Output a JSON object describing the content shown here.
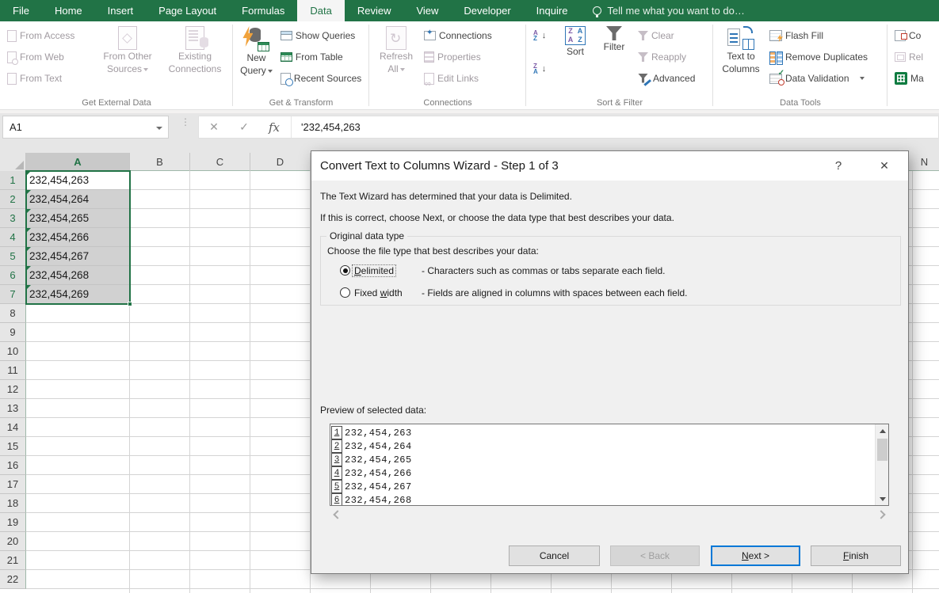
{
  "tabs": [
    "File",
    "Home",
    "Insert",
    "Page Layout",
    "Formulas",
    "Data",
    "Review",
    "View",
    "Developer",
    "Inquire"
  ],
  "tell_me": "Tell me what you want to do…",
  "ribbon": {
    "get_external": {
      "label": "Get External Data",
      "from_access": "From Access",
      "from_web": "From Web",
      "from_text": "From Text",
      "from_other_1": "From Other",
      "from_other_2": "Sources",
      "existing_1": "Existing",
      "existing_2": "Connections"
    },
    "get_transform": {
      "label": "Get & Transform",
      "new_query_1": "New",
      "new_query_2": "Query",
      "show_queries": "Show Queries",
      "from_table": "From Table",
      "recent_sources": "Recent Sources"
    },
    "connections_group": {
      "label": "Connections",
      "refresh_1": "Refresh",
      "refresh_2": "All",
      "connections": "Connections",
      "properties": "Properties",
      "edit_links": "Edit Links"
    },
    "sort_filter": {
      "label": "Sort & Filter",
      "sort": "Sort",
      "filter": "Filter",
      "clear": "Clear",
      "reapply": "Reapply",
      "advanced": "Advanced"
    },
    "data_tools": {
      "label": "Data Tools",
      "ttc_1": "Text to",
      "ttc_2": "Columns",
      "flash_fill": "Flash Fill",
      "remove_duplicates": "Remove Duplicates",
      "data_validation": "Data Validation"
    },
    "cutoff": {
      "consolidate": "Co",
      "relationships": "Rel",
      "manage": "Ma"
    }
  },
  "icons": {
    "sort_large": [
      "Z",
      "A",
      "A",
      "Z"
    ],
    "az_small": [
      "A",
      "Z"
    ],
    "za_small": [
      "Z",
      "A"
    ],
    "down_arrow": "↓"
  },
  "formula_bar": {
    "name_box": "A1",
    "cancel_glyph": "✕",
    "enter_glyph": "✓",
    "fx": "fx",
    "formula": "'232,454,263"
  },
  "sheet": {
    "col_a": "A",
    "col_b": "B",
    "col_c": "C",
    "col_d": "D",
    "col_n": "N",
    "row_headers": [
      "1",
      "2",
      "3",
      "4",
      "5",
      "6",
      "7",
      "8",
      "9",
      "10",
      "11",
      "12",
      "13",
      "14",
      "15",
      "16",
      "17",
      "18",
      "19",
      "20",
      "21",
      "22"
    ],
    "cells": [
      "232,454,263",
      "232,454,264",
      "232,454,265",
      "232,454,266",
      "232,454,267",
      "232,454,268",
      "232,454,269"
    ]
  },
  "dialog": {
    "title": "Convert Text to Columns Wizard - Step 1 of 3",
    "help_glyph": "?",
    "close_glyph": "✕",
    "line1": "The Text Wizard has determined that your data is Delimited.",
    "line2": "If this is correct, choose Next, or choose the data type that best describes your data.",
    "groupbox_label": "Original data type",
    "choose_label": "Choose the file type that best describes your data:",
    "delimited_parts": [
      "",
      "D",
      "elimited"
    ],
    "delimited_desc": "- Characters such as commas or tabs separate each field.",
    "fixed_parts": [
      "Fixed ",
      "w",
      "idth"
    ],
    "fixed_desc": "- Fields are aligned in columns with spaces between each field.",
    "preview_label": "Preview of selected data:",
    "preview_rows": [
      {
        "num": "1",
        "value": "232,454,263"
      },
      {
        "num": "2",
        "value": "232,454,264"
      },
      {
        "num": "3",
        "value": "232,454,265"
      },
      {
        "num": "4",
        "value": "232,454,266"
      },
      {
        "num": "5",
        "value": "232,454,267"
      },
      {
        "num": "6",
        "value": "232,454,268"
      }
    ],
    "buttons": {
      "cancel": "Cancel",
      "back": "< Back",
      "next_parts": [
        "",
        "N",
        "ext >"
      ],
      "finish_parts": [
        "",
        "F",
        "inish"
      ]
    }
  },
  "colors": {
    "excel_green": "#217346",
    "selection_fill": "#d1d1d1",
    "default_button_border": "#0078d7"
  }
}
